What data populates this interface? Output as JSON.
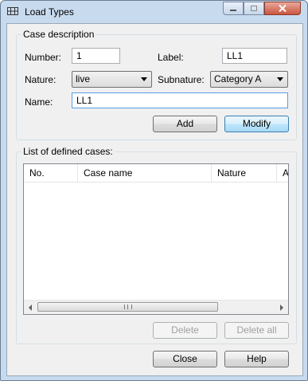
{
  "window": {
    "title": "Load Types",
    "app_icon": "grid-icon"
  },
  "case_description": {
    "legend": "Case description",
    "number_label": "Number:",
    "number_value": "1",
    "label_label": "Label:",
    "label_value": "LL1",
    "nature_label": "Nature:",
    "nature_value": "live",
    "subnature_label": "Subnature:",
    "subnature_value": "Category A",
    "name_label": "Name:",
    "name_value": "LL1",
    "add_button": "Add",
    "modify_button": "Modify"
  },
  "defined_cases": {
    "legend": "List of defined cases:",
    "columns": [
      "No.",
      "Case name",
      "Nature",
      "A"
    ],
    "rows": [],
    "scroll_grip": "III",
    "delete_button": "Delete",
    "delete_all_button": "Delete all"
  },
  "footer": {
    "close_button": "Close",
    "help_button": "Help"
  }
}
